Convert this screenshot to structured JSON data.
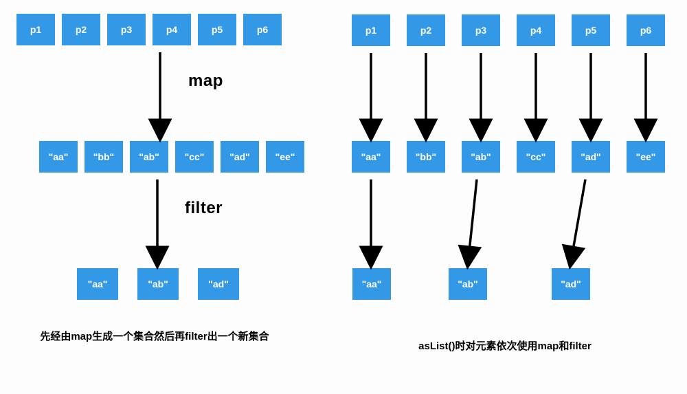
{
  "left": {
    "row1": [
      "p1",
      "p2",
      "p3",
      "p4",
      "p5",
      "p6"
    ],
    "op1": "map",
    "row2": [
      "\"aa\"",
      "\"bb\"",
      "\"ab\"",
      "\"cc\"",
      "\"ad\"",
      "\"ee\""
    ],
    "op2": "filter",
    "row3": [
      "\"aa\"",
      "\"ab\"",
      "\"ad\""
    ],
    "caption": "先经由map生成一个集合然后再filter出一个新集合"
  },
  "right": {
    "row1": [
      "p1",
      "p2",
      "p3",
      "p4",
      "p5",
      "p6"
    ],
    "row2": [
      "\"aa\"",
      "\"bb\"",
      "\"ab\"",
      "\"cc\"",
      "\"ad\"",
      "\"ee\""
    ],
    "row3": [
      "\"aa\"",
      "\"ab\"",
      "\"ad\""
    ],
    "caption": "asList()时对元素依次使用map和filter"
  },
  "colors": {
    "box": "#3399e6"
  }
}
